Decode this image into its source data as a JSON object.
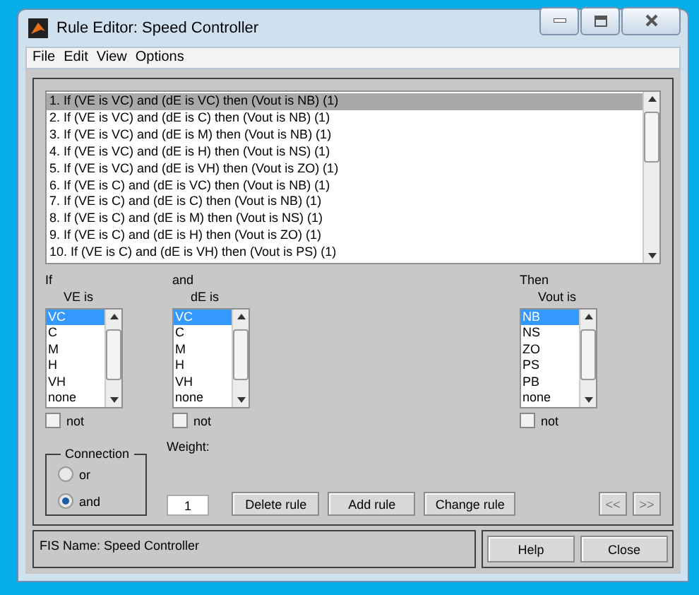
{
  "window": {
    "title": "Rule Editor: Speed Controller"
  },
  "menu": [
    "File",
    "Edit",
    "View",
    "Options"
  ],
  "rules": [
    {
      "text": "1. If (VE is VC) and (dE is VC) then (Vout is NB) (1)",
      "selected": true
    },
    {
      "text": "2. If (VE is VC) and (dE is C) then (Vout is NB) (1)",
      "selected": false
    },
    {
      "text": "3. If (VE is VC) and (dE is M) then (Vout is NB) (1)",
      "selected": false
    },
    {
      "text": "4. If (VE is VC) and (dE is H) then (Vout is NS) (1)",
      "selected": false
    },
    {
      "text": "5. If (VE is VC) and (dE is VH) then (Vout is ZO) (1)",
      "selected": false
    },
    {
      "text": "6. If (VE is C) and (dE is VC) then (Vout is NB) (1)",
      "selected": false
    },
    {
      "text": "7. If (VE is C) and (dE is C) then (Vout is NB) (1)",
      "selected": false
    },
    {
      "text": "8. If (VE is C) and (dE is M) then (Vout is NS) (1)",
      "selected": false
    },
    {
      "text": "9. If (VE is C) and (dE is H) then (Vout is ZO) (1)",
      "selected": false
    },
    {
      "text": "10. If (VE is C) and (dE is VH) then (Vout is PS) (1)",
      "selected": false
    }
  ],
  "columns": [
    {
      "heading": "If",
      "variable": "VE is",
      "items": [
        {
          "label": "VC",
          "selected": true
        },
        {
          "label": "C",
          "selected": false
        },
        {
          "label": "M",
          "selected": false
        },
        {
          "label": "H",
          "selected": false
        },
        {
          "label": "VH",
          "selected": false
        },
        {
          "label": "none",
          "selected": false
        }
      ],
      "not": {
        "label": "not",
        "checked": false
      }
    },
    {
      "heading": "and",
      "variable": "dE is",
      "items": [
        {
          "label": "VC",
          "selected": true
        },
        {
          "label": "C",
          "selected": false
        },
        {
          "label": "M",
          "selected": false
        },
        {
          "label": "H",
          "selected": false
        },
        {
          "label": "VH",
          "selected": false
        },
        {
          "label": "none",
          "selected": false
        }
      ],
      "not": {
        "label": "not",
        "checked": false
      }
    },
    {
      "heading": "Then",
      "variable": "Vout is",
      "items": [
        {
          "label": "NB",
          "selected": true
        },
        {
          "label": "NS",
          "selected": false
        },
        {
          "label": "ZO",
          "selected": false
        },
        {
          "label": "PS",
          "selected": false
        },
        {
          "label": "PB",
          "selected": false
        },
        {
          "label": "none",
          "selected": false
        }
      ],
      "not": {
        "label": "not",
        "checked": false
      }
    }
  ],
  "connection": {
    "title": "Connection",
    "options": [
      {
        "label": "or",
        "selected": false
      },
      {
        "label": "and",
        "selected": true
      }
    ]
  },
  "weight": {
    "label": "Weight:",
    "value": "1"
  },
  "rule_buttons": [
    "Delete rule",
    "Add rule",
    "Change rule"
  ],
  "nav_buttons": [
    {
      "label": "<<",
      "disabled": true
    },
    {
      "label": ">>",
      "disabled": true
    }
  ],
  "status": "FIS Name: Speed Controller",
  "footer_buttons": [
    "Help",
    "Close"
  ]
}
